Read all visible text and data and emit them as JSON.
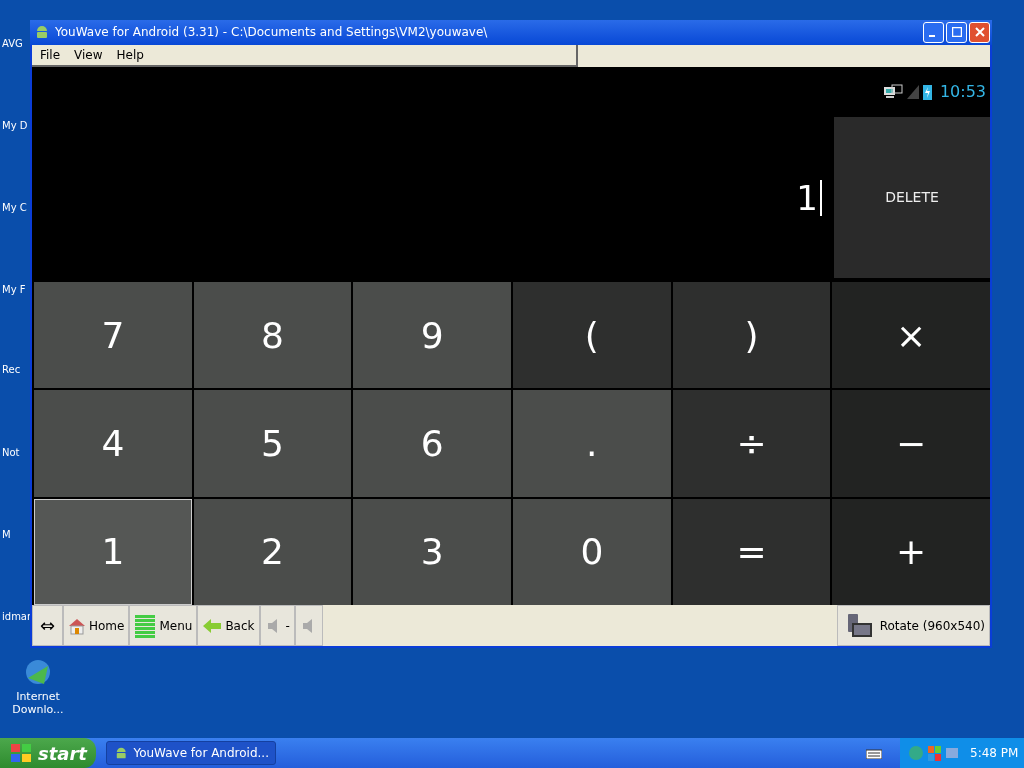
{
  "desktop_icons": [
    {
      "label": "AVG"
    },
    {
      "label": "My D"
    },
    {
      "label": "My C"
    },
    {
      "label": "My F"
    },
    {
      "label": "Rec"
    },
    {
      "label": "Not"
    },
    {
      "label": "M"
    },
    {
      "label": "idmar"
    },
    {
      "label": "Internet Downlo..."
    }
  ],
  "window": {
    "title": "YouWave for Android (3.31) - C:\\Documents and Settings\\VM2\\youwave\\"
  },
  "menu": [
    "File",
    "View",
    "Help"
  ],
  "android_status": {
    "time": "10:53"
  },
  "display": {
    "value": "1",
    "delete_label": "DELETE"
  },
  "keys": [
    {
      "label": "7",
      "kind": "digit",
      "selected": false
    },
    {
      "label": "8",
      "kind": "digit",
      "selected": false
    },
    {
      "label": "9",
      "kind": "digit",
      "selected": false
    },
    {
      "label": "(",
      "kind": "paren",
      "selected": false
    },
    {
      "label": ")",
      "kind": "paren",
      "selected": false
    },
    {
      "label": "×",
      "kind": "operator",
      "selected": false
    },
    {
      "label": "4",
      "kind": "digit",
      "selected": false
    },
    {
      "label": "5",
      "kind": "digit",
      "selected": false
    },
    {
      "label": "6",
      "kind": "digit",
      "selected": false
    },
    {
      "label": ".",
      "kind": "digit",
      "selected": false
    },
    {
      "label": "÷",
      "kind": "paren",
      "selected": false
    },
    {
      "label": "−",
      "kind": "operator",
      "selected": false
    },
    {
      "label": "1",
      "kind": "digit",
      "selected": true
    },
    {
      "label": "2",
      "kind": "digit",
      "selected": false
    },
    {
      "label": "3",
      "kind": "digit",
      "selected": false
    },
    {
      "label": "0",
      "kind": "digit",
      "selected": false
    },
    {
      "label": "=",
      "kind": "paren",
      "selected": false
    },
    {
      "label": "+",
      "kind": "operator",
      "selected": false
    }
  ],
  "toolbar": {
    "resize": "⇔",
    "buttons": [
      {
        "label": "Home",
        "kind": "home"
      },
      {
        "label": "Menu",
        "kind": "menu"
      },
      {
        "label": "Back",
        "kind": "back"
      },
      {
        "label": "-",
        "kind": "vol-down"
      },
      {
        "kind": "vol-up"
      }
    ],
    "rotate": "Rotate (960x540)"
  },
  "taskbar": {
    "start": "start",
    "task": "YouWave for Android...",
    "clock": "5:48 PM"
  }
}
